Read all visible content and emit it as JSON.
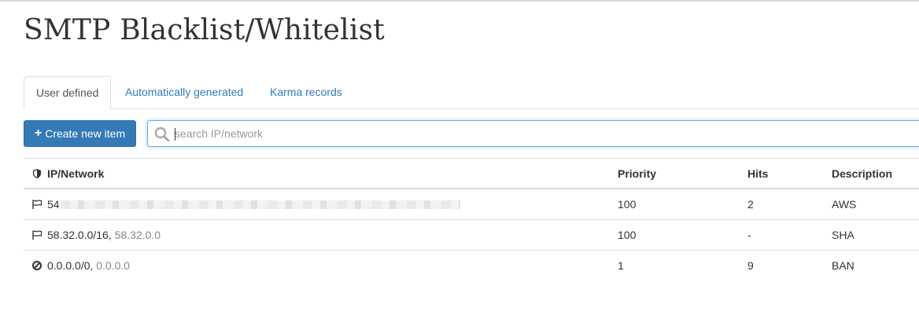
{
  "page": {
    "title": "SMTP Blacklist/Whitelist"
  },
  "tabs": [
    {
      "label": "User defined",
      "active": true
    },
    {
      "label": "Automatically generated",
      "active": false
    },
    {
      "label": "Karma records",
      "active": false
    }
  ],
  "toolbar": {
    "create_label": "Create new item",
    "search_placeholder": "search IP/network",
    "search_value": ""
  },
  "table": {
    "headers": {
      "ip": "IP/Network",
      "priority": "Priority",
      "hits": "Hits",
      "description": "Description"
    },
    "rows": [
      {
        "icon": "flag-icon",
        "network": "54",
        "address": "",
        "priority": "100",
        "hits": "2",
        "description": "AWS",
        "redacted": true
      },
      {
        "icon": "flag-icon",
        "network": "58.32.0.0/16,",
        "address": "58.32.0.0",
        "priority": "100",
        "hits": "-",
        "description": "SHA"
      },
      {
        "icon": "ban-icon",
        "network": "0.0.0.0/0,",
        "address": "0.0.0.0",
        "priority": "1",
        "hits": "9",
        "description": "BAN"
      }
    ]
  },
  "colors": {
    "link": "#337ab7",
    "primary_button": "#337ab7",
    "border": "#dddddd",
    "muted_text": "#888888"
  }
}
